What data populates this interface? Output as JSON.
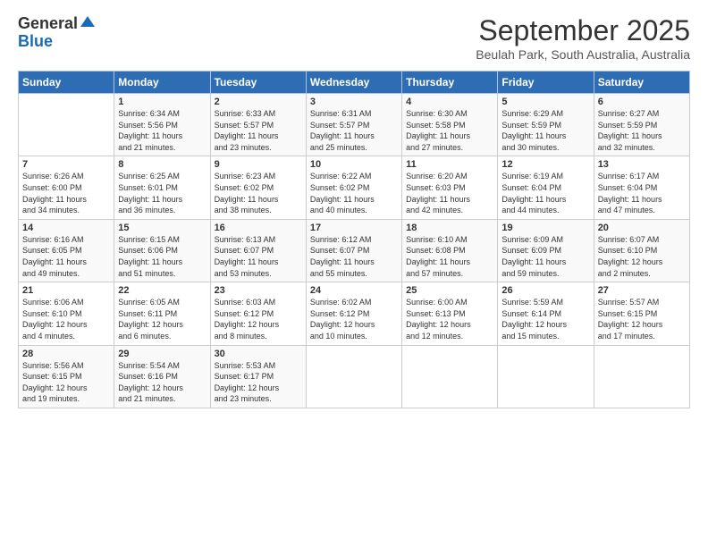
{
  "header": {
    "logo_general": "General",
    "logo_blue": "Blue",
    "month": "September 2025",
    "location": "Beulah Park, South Australia, Australia"
  },
  "days_of_week": [
    "Sunday",
    "Monday",
    "Tuesday",
    "Wednesday",
    "Thursday",
    "Friday",
    "Saturday"
  ],
  "weeks": [
    [
      {
        "day": "",
        "info": ""
      },
      {
        "day": "1",
        "info": "Sunrise: 6:34 AM\nSunset: 5:56 PM\nDaylight: 11 hours\nand 21 minutes."
      },
      {
        "day": "2",
        "info": "Sunrise: 6:33 AM\nSunset: 5:57 PM\nDaylight: 11 hours\nand 23 minutes."
      },
      {
        "day": "3",
        "info": "Sunrise: 6:31 AM\nSunset: 5:57 PM\nDaylight: 11 hours\nand 25 minutes."
      },
      {
        "day": "4",
        "info": "Sunrise: 6:30 AM\nSunset: 5:58 PM\nDaylight: 11 hours\nand 27 minutes."
      },
      {
        "day": "5",
        "info": "Sunrise: 6:29 AM\nSunset: 5:59 PM\nDaylight: 11 hours\nand 30 minutes."
      },
      {
        "day": "6",
        "info": "Sunrise: 6:27 AM\nSunset: 5:59 PM\nDaylight: 11 hours\nand 32 minutes."
      }
    ],
    [
      {
        "day": "7",
        "info": "Sunrise: 6:26 AM\nSunset: 6:00 PM\nDaylight: 11 hours\nand 34 minutes."
      },
      {
        "day": "8",
        "info": "Sunrise: 6:25 AM\nSunset: 6:01 PM\nDaylight: 11 hours\nand 36 minutes."
      },
      {
        "day": "9",
        "info": "Sunrise: 6:23 AM\nSunset: 6:02 PM\nDaylight: 11 hours\nand 38 minutes."
      },
      {
        "day": "10",
        "info": "Sunrise: 6:22 AM\nSunset: 6:02 PM\nDaylight: 11 hours\nand 40 minutes."
      },
      {
        "day": "11",
        "info": "Sunrise: 6:20 AM\nSunset: 6:03 PM\nDaylight: 11 hours\nand 42 minutes."
      },
      {
        "day": "12",
        "info": "Sunrise: 6:19 AM\nSunset: 6:04 PM\nDaylight: 11 hours\nand 44 minutes."
      },
      {
        "day": "13",
        "info": "Sunrise: 6:17 AM\nSunset: 6:04 PM\nDaylight: 11 hours\nand 47 minutes."
      }
    ],
    [
      {
        "day": "14",
        "info": "Sunrise: 6:16 AM\nSunset: 6:05 PM\nDaylight: 11 hours\nand 49 minutes."
      },
      {
        "day": "15",
        "info": "Sunrise: 6:15 AM\nSunset: 6:06 PM\nDaylight: 11 hours\nand 51 minutes."
      },
      {
        "day": "16",
        "info": "Sunrise: 6:13 AM\nSunset: 6:07 PM\nDaylight: 11 hours\nand 53 minutes."
      },
      {
        "day": "17",
        "info": "Sunrise: 6:12 AM\nSunset: 6:07 PM\nDaylight: 11 hours\nand 55 minutes."
      },
      {
        "day": "18",
        "info": "Sunrise: 6:10 AM\nSunset: 6:08 PM\nDaylight: 11 hours\nand 57 minutes."
      },
      {
        "day": "19",
        "info": "Sunrise: 6:09 AM\nSunset: 6:09 PM\nDaylight: 11 hours\nand 59 minutes."
      },
      {
        "day": "20",
        "info": "Sunrise: 6:07 AM\nSunset: 6:10 PM\nDaylight: 12 hours\nand 2 minutes."
      }
    ],
    [
      {
        "day": "21",
        "info": "Sunrise: 6:06 AM\nSunset: 6:10 PM\nDaylight: 12 hours\nand 4 minutes."
      },
      {
        "day": "22",
        "info": "Sunrise: 6:05 AM\nSunset: 6:11 PM\nDaylight: 12 hours\nand 6 minutes."
      },
      {
        "day": "23",
        "info": "Sunrise: 6:03 AM\nSunset: 6:12 PM\nDaylight: 12 hours\nand 8 minutes."
      },
      {
        "day": "24",
        "info": "Sunrise: 6:02 AM\nSunset: 6:12 PM\nDaylight: 12 hours\nand 10 minutes."
      },
      {
        "day": "25",
        "info": "Sunrise: 6:00 AM\nSunset: 6:13 PM\nDaylight: 12 hours\nand 12 minutes."
      },
      {
        "day": "26",
        "info": "Sunrise: 5:59 AM\nSunset: 6:14 PM\nDaylight: 12 hours\nand 15 minutes."
      },
      {
        "day": "27",
        "info": "Sunrise: 5:57 AM\nSunset: 6:15 PM\nDaylight: 12 hours\nand 17 minutes."
      }
    ],
    [
      {
        "day": "28",
        "info": "Sunrise: 5:56 AM\nSunset: 6:15 PM\nDaylight: 12 hours\nand 19 minutes."
      },
      {
        "day": "29",
        "info": "Sunrise: 5:54 AM\nSunset: 6:16 PM\nDaylight: 12 hours\nand 21 minutes."
      },
      {
        "day": "30",
        "info": "Sunrise: 5:53 AM\nSunset: 6:17 PM\nDaylight: 12 hours\nand 23 minutes."
      },
      {
        "day": "",
        "info": ""
      },
      {
        "day": "",
        "info": ""
      },
      {
        "day": "",
        "info": ""
      },
      {
        "day": "",
        "info": ""
      }
    ]
  ]
}
